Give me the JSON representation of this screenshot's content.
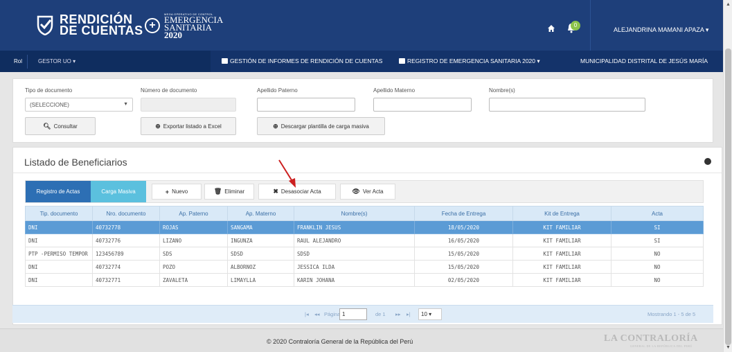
{
  "header": {
    "logo_primary_line1": "RENDICIÓN",
    "logo_primary_line2": "DE CUENTAS",
    "logo_secondary_small": "MEGA OPERATIVO DE CONTROL",
    "logo_secondary_line1": "EMERGENCIA",
    "logo_secondary_line2": "SANITARIA",
    "logo_secondary_line3": "2020",
    "notification_count": "0",
    "user_name": "ALEJANDRINA MAMANI APAZA",
    "home_icon": "home-icon",
    "bell_icon": "bell-icon",
    "header_bg": "#1e3f7a"
  },
  "nav": {
    "rol_label": "Rol",
    "gestor_label": "GESTOR UO",
    "items": [
      "GESTIÓN DE INFORMES DE RENDICIÓN DE CUENTAS",
      "REGISTRO DE EMERGENCIA SANITARIA 2020"
    ],
    "municipality": "MUNICIPALIDAD DISTRITAL DE JESÚS MARÍA"
  },
  "filters": {
    "tipo_label": "Tipo de documento",
    "tipo_value": "(SELECCIONE)",
    "numero_label": "Número de documento",
    "paterno_label": "Apellido Paterno",
    "materno_label": "Apellido Materno",
    "nombres_label": "Nombre(s)",
    "consultar": "Consultar",
    "exportar": "Exportar listado a Excel",
    "descargar": "Descargar plantilla de carga masiva"
  },
  "list": {
    "title": "Listado de Beneficiarios",
    "tabs": {
      "registro": "Registro de Actas",
      "carga": "Carga Masiva",
      "nuevo": "Nuevo",
      "eliminar": "Eliminar",
      "desasociar": "Desasociar Acta",
      "ver": "Ver Acta"
    },
    "columns": [
      "Tip. documento",
      "Nro. documento",
      "Ap. Paterno",
      "Ap. Materno",
      "Nombre(s)",
      "Fecha de Entrega",
      "Kit de Entrega",
      "Acta"
    ],
    "rows": [
      [
        "DNI",
        "40732778",
        "ROJAS",
        "SANGAMA",
        "FRANKLIN JESUS",
        "18/05/2020",
        "KIT FAMILIAR",
        "SI"
      ],
      [
        "DNI",
        "40732776",
        "LIZANO",
        "INGUNZA",
        "RAUL ALEJANDRO",
        "16/05/2020",
        "KIT FAMILIAR",
        "SI"
      ],
      [
        "PTP -PERMISO TEMPOR",
        "123456789",
        "SDS",
        "SDSD",
        "SDSD",
        "15/05/2020",
        "KIT FAMILIAR",
        "NO"
      ],
      [
        "DNI",
        "40732774",
        "POZO",
        "ALBORNOZ",
        "JESSICA ILDA",
        "15/05/2020",
        "KIT FAMILIAR",
        "NO"
      ],
      [
        "DNI",
        "40732771",
        "ZAVALETA",
        "LIMAYLLA",
        "KARIN JOHANA",
        "02/05/2020",
        "KIT FAMILIAR",
        "NO"
      ]
    ]
  },
  "pager": {
    "pagina_label": "Página",
    "page_value": "1",
    "de_label": "de 1",
    "page_size": "10",
    "summary": "Mostrando 1 - 5 de 5"
  },
  "footer": {
    "copyright": "© 2020 Contraloría General de la República del Perú",
    "logo_line1": "LA CONTRALORÍA",
    "logo_line2": "GENERAL DE LA REPÚBLICA DEL PERÚ"
  }
}
